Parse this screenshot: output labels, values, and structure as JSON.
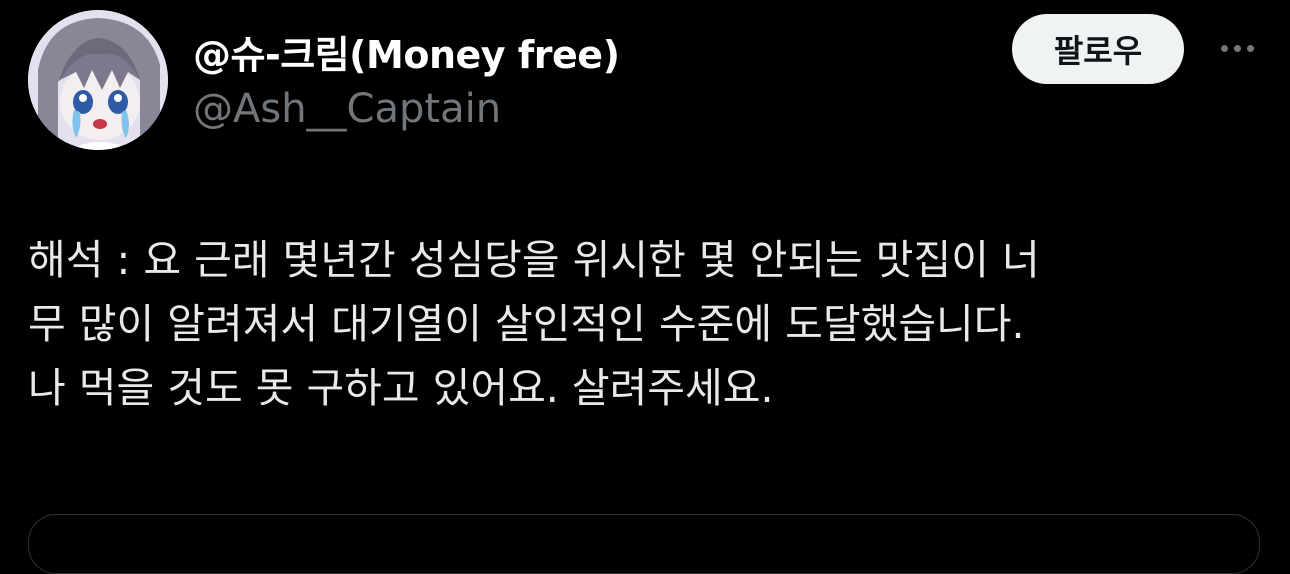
{
  "author": {
    "display_name": "@슈-크림(Money free)",
    "handle": "@Ash__Captain",
    "avatar_icon": "anime-avatar-crying"
  },
  "actions": {
    "follow_label": "팔로우",
    "more_icon": "more-horizontal-icon"
  },
  "tweet": {
    "lines": [
      "해석 : 요 근래 몇년간 성심당을 위시한 몇 안되는 맛집이 너",
      "무 많이 알려져서 대기열이 살인적인 수준에 도달했습니다.",
      "나 먹을 것도 못 구하고 있어요. 살려주세요."
    ]
  },
  "colors": {
    "background": "#000000",
    "text_primary": "#e7e9ea",
    "text_secondary": "#71767b",
    "button_bg": "#eff3f4",
    "button_text": "#0f1419",
    "border": "#2f3336"
  }
}
